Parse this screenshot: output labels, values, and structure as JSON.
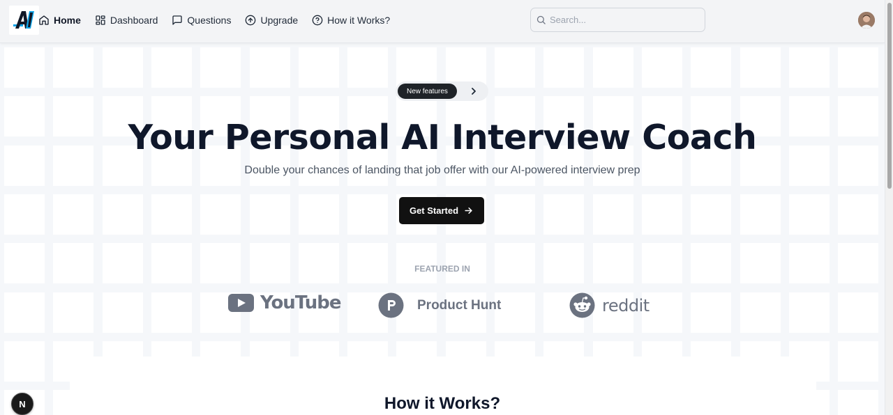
{
  "header": {
    "logo_text": "AI",
    "nav": [
      {
        "label": "Home",
        "icon": "home-icon",
        "active": true
      },
      {
        "label": "Dashboard",
        "icon": "dashboard-icon",
        "active": false
      },
      {
        "label": "Questions",
        "icon": "message-square-icon",
        "active": false
      },
      {
        "label": "Upgrade",
        "icon": "arrow-up-circle-icon",
        "active": false
      },
      {
        "label": "How it Works?",
        "icon": "help-circle-icon",
        "active": false
      }
    ],
    "search": {
      "placeholder": "Search...",
      "value": ""
    },
    "avatar_icon": "user-avatar"
  },
  "hero": {
    "badge_label": "New features",
    "title": "Your Personal AI Interview Coach",
    "subtitle": "Double your chances of landing that job offer with our AI-powered interview prep",
    "cta_label": "Get Started"
  },
  "featured": {
    "label": "FEATURED IN",
    "brands": [
      {
        "name": "YouTube",
        "icon": "youtube-logo"
      },
      {
        "name": "Product Hunt",
        "icon": "product-hunt-logo"
      },
      {
        "name": "reddit",
        "icon": "reddit-logo"
      }
    ]
  },
  "how_it_works": {
    "title": "How it Works?"
  },
  "dev_badge": {
    "label": "N"
  },
  "colors": {
    "primary_button": "#111111",
    "title": "#0f172a",
    "muted": "#6b7280",
    "grid_bg": "#f5f7fa"
  }
}
